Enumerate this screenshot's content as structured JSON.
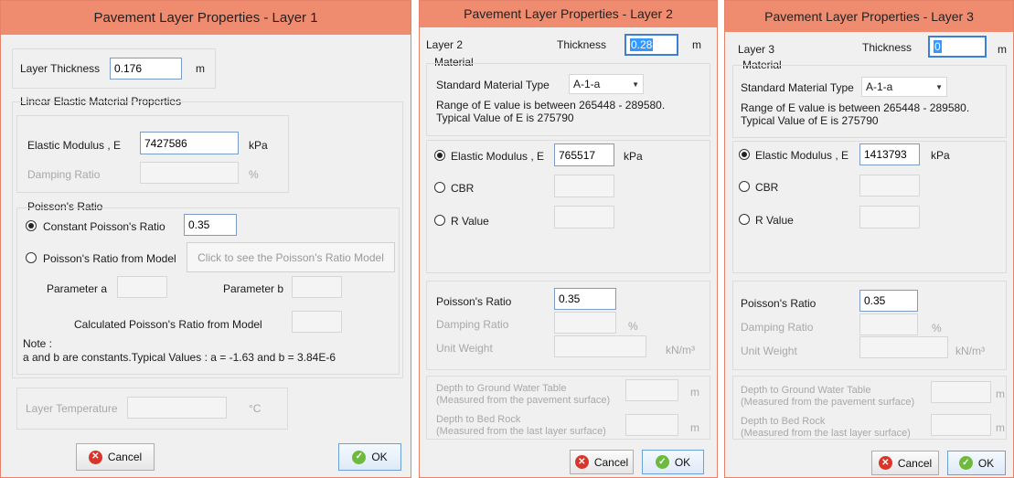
{
  "dialog1": {
    "title": "Pavement Layer Properties - Layer 1",
    "layer_thickness_label": "Layer Thickness",
    "layer_thickness_value": "0.176",
    "thickness_unit": "m",
    "linear_elastic_title": "Linear Elastic Material Properties",
    "elastic_modulus_label": "Elastic Modulus , E",
    "elastic_modulus_value": "7427586",
    "elastic_unit": "kPa",
    "damping_label": "Damping Ratio",
    "damping_unit": "%",
    "poisson_title": "Poisson's Ratio",
    "constant_poisson_label": "Constant Poisson's Ratio",
    "constant_poisson_value": "0.35",
    "model_poisson_label": "Poisson's Ratio from Model",
    "model_button_label": "Click to see the Poisson's Ratio Model",
    "param_a_label": "Parameter a",
    "param_b_label": "Parameter b",
    "calculated_label": "Calculated Poisson's Ratio from Model",
    "note_title": "Note :",
    "note_text": "a and b are constants.Typical Values : a = -1.63  and  b =  3.84E-6",
    "temperature_label": "Layer Temperature",
    "temperature_unit": "°C",
    "cancel_label": "Cancel",
    "ok_label": "OK"
  },
  "dialog2": {
    "title": "Pavement Layer Properties - Layer 2",
    "layer_label": "Layer 2",
    "thickness_label": "Thickness",
    "thickness_value": "0.28",
    "thickness_unit": "m",
    "material_label": "Material",
    "std_material_label": "Standard Material Type",
    "std_material_value": "A-1-a",
    "range_line1": "Range of E value is between 265448 - 289580.",
    "range_line2": "Typical Value of E is 275790",
    "elastic_label": "Elastic Modulus , E",
    "elastic_value": "765517",
    "elastic_unit": "kPa",
    "cbr_label": "CBR",
    "rvalue_label": "R Value",
    "poisson_label": "Poisson's Ratio",
    "poisson_value": "0.35",
    "damping_label": "Damping Ratio",
    "damping_unit": "%",
    "unit_weight_label": "Unit Weight",
    "unit_weight_unit": "kN/m³",
    "gw_label1": "Depth to Ground Water Table",
    "gw_label2": "(Measured from the pavement surface)",
    "gw_unit": "m",
    "bedrock_label1": "Depth to Bed Rock",
    "bedrock_label2": "(Measured from the last layer surface)",
    "bedrock_unit": "m",
    "cancel_label": "Cancel",
    "ok_label": "OK"
  },
  "dialog3": {
    "title": "Pavement Layer Properties - Layer 3",
    "layer_label": "Layer 3",
    "thickness_label": "Thickness",
    "thickness_value": "0",
    "thickness_unit": "m",
    "material_label": "Material",
    "std_material_label": "Standard Material Type",
    "std_material_value": "A-1-a",
    "range_line1": "Range of E value is between 265448 - 289580.",
    "range_line2": "Typical Value of E is 275790",
    "elastic_label": "Elastic Modulus , E",
    "elastic_value": "1413793",
    "elastic_unit": "kPa",
    "cbr_label": "CBR",
    "rvalue_label": "R Value",
    "poisson_label": "Poisson's Ratio",
    "poisson_value": "0.35",
    "damping_label": "Damping Ratio",
    "damping_unit": "%",
    "unit_weight_label": "Unit Weight",
    "unit_weight_unit": "kN/m³",
    "gw_label1": "Depth to Ground Water Table",
    "gw_label2": "(Measured from the pavement surface)",
    "gw_unit": "m",
    "bedrock_label1": "Depth to Bed Rock",
    "bedrock_label2": "(Measured from the last layer surface)",
    "bedrock_unit": "m",
    "cancel_label": "Cancel",
    "ok_label": "OK"
  },
  "colors": {
    "titlebar": "#ef8c70",
    "dialog_bg": "#f0f0f0",
    "cancel_icon": "#d9362b",
    "ok_icon": "#6cbb3c",
    "selection": "#3399ff"
  },
  "icons": {
    "cancel": "cancel-icon",
    "ok": "ok-icon",
    "dropdown": "chevron-down-icon"
  }
}
